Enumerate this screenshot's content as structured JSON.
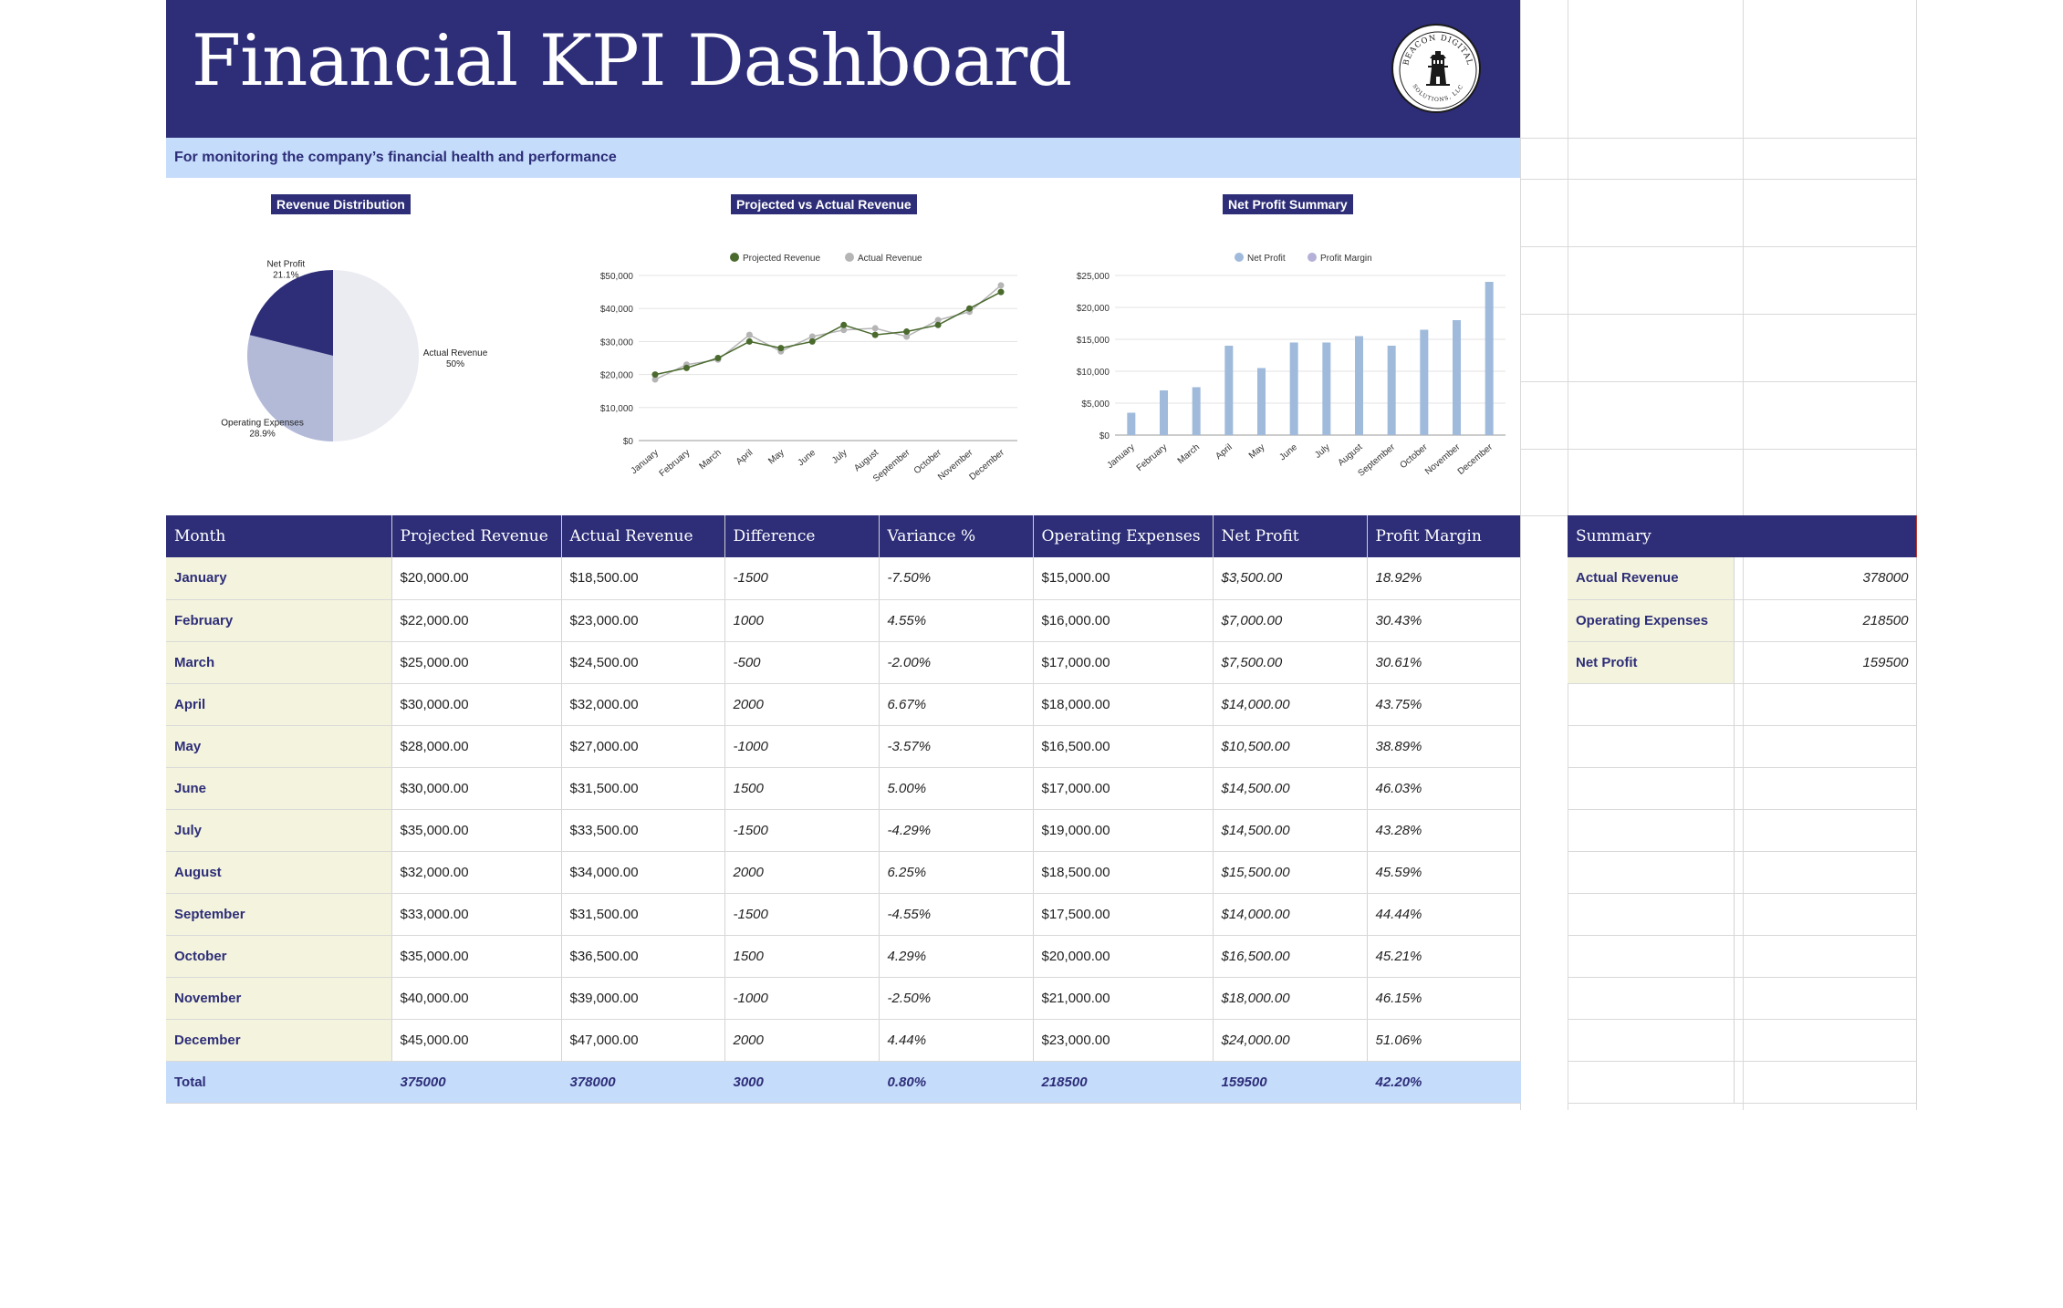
{
  "header": {
    "title": "Financial KPI Dashboard",
    "subtitle": "For monitoring the company’s financial health and performance",
    "logo_text": "BEACON DIGITAL SOLUTIONS, LLC",
    "colors": {
      "banner": "#2d2d78",
      "subtitle_bar": "#c5dcfb",
      "month_cell": "#f4f4de"
    }
  },
  "chart_data": [
    {
      "type": "pie",
      "title": "Revenue Distribution",
      "categories": [
        "Actual Revenue",
        "Operating Expenses",
        "Net Profit"
      ],
      "values": [
        50,
        28.9,
        21.1
      ],
      "labels": [
        "50%",
        "28.9%",
        "21.1%"
      ],
      "colors": [
        "#ebebf2",
        "#b3bad8",
        "#2d2d78"
      ]
    },
    {
      "type": "line",
      "title": "Projected vs Actual Revenue",
      "categories": [
        "January",
        "February",
        "March",
        "April",
        "May",
        "June",
        "July",
        "August",
        "September",
        "October",
        "November",
        "December"
      ],
      "series": [
        {
          "name": "Projected Revenue",
          "values": [
            20000,
            22000,
            25000,
            30000,
            28000,
            30000,
            35000,
            32000,
            33000,
            35000,
            40000,
            45000
          ],
          "color": "#4a6a2e"
        },
        {
          "name": "Actual Revenue",
          "values": [
            18500,
            23000,
            24500,
            32000,
            27000,
            31500,
            33500,
            34000,
            31500,
            36500,
            39000,
            47000
          ],
          "color": "#b5b5b5"
        }
      ],
      "ylim": [
        0,
        50000
      ],
      "yticks": [
        "$0",
        "$10,000",
        "$20,000",
        "$30,000",
        "$40,000",
        "$50,000"
      ],
      "legend": "top",
      "grid": true
    },
    {
      "type": "bar",
      "title": "Net Profit Summary",
      "categories": [
        "January",
        "February",
        "March",
        "April",
        "May",
        "June",
        "July",
        "August",
        "September",
        "October",
        "November",
        "December"
      ],
      "series": [
        {
          "name": "Net Profit",
          "values": [
            3500,
            7000,
            7500,
            14000,
            10500,
            14500,
            14500,
            15500,
            14000,
            16500,
            18000,
            24000
          ],
          "color": "#9fbadb"
        },
        {
          "name": "Profit Margin",
          "values": [],
          "color": "#b4b0d8"
        }
      ],
      "ylim": [
        0,
        25000
      ],
      "yticks": [
        "$0",
        "$5,000",
        "$10,000",
        "$15,000",
        "$20,000",
        "$25,000"
      ],
      "legend": "top",
      "grid": true
    }
  ],
  "table": {
    "headers": [
      "Month",
      "Projected Revenue",
      "Actual Revenue",
      "Difference",
      "Variance %",
      "Operating Expenses",
      "Net Profit",
      "Profit Margin"
    ],
    "rows": [
      [
        "January",
        "$20,000.00",
        "$18,500.00",
        "-1500",
        "-7.50%",
        "$15,000.00",
        "$3,500.00",
        "18.92%"
      ],
      [
        "February",
        "$22,000.00",
        "$23,000.00",
        "1000",
        "4.55%",
        "$16,000.00",
        "$7,000.00",
        "30.43%"
      ],
      [
        "March",
        "$25,000.00",
        "$24,500.00",
        "-500",
        "-2.00%",
        "$17,000.00",
        "$7,500.00",
        "30.61%"
      ],
      [
        "April",
        "$30,000.00",
        "$32,000.00",
        "2000",
        "6.67%",
        "$18,000.00",
        "$14,000.00",
        "43.75%"
      ],
      [
        "May",
        "$28,000.00",
        "$27,000.00",
        "-1000",
        "-3.57%",
        "$16,500.00",
        "$10,500.00",
        "38.89%"
      ],
      [
        "June",
        "$30,000.00",
        "$31,500.00",
        "1500",
        "5.00%",
        "$17,000.00",
        "$14,500.00",
        "46.03%"
      ],
      [
        "July",
        "$35,000.00",
        "$33,500.00",
        "-1500",
        "-4.29%",
        "$19,000.00",
        "$14,500.00",
        "43.28%"
      ],
      [
        "August",
        "$32,000.00",
        "$34,000.00",
        "2000",
        "6.25%",
        "$18,500.00",
        "$15,500.00",
        "45.59%"
      ],
      [
        "September",
        "$33,000.00",
        "$31,500.00",
        "-1500",
        "-4.55%",
        "$17,500.00",
        "$14,000.00",
        "44.44%"
      ],
      [
        "October",
        "$35,000.00",
        "$36,500.00",
        "1500",
        "4.29%",
        "$20,000.00",
        "$16,500.00",
        "45.21%"
      ],
      [
        "November",
        "$40,000.00",
        "$39,000.00",
        "-1000",
        "-2.50%",
        "$21,000.00",
        "$18,000.00",
        "46.15%"
      ],
      [
        "December",
        "$45,000.00",
        "$47,000.00",
        "2000",
        "4.44%",
        "$23,000.00",
        "$24,000.00",
        "51.06%"
      ]
    ],
    "total": [
      "Total",
      "375000",
      "378000",
      "3000",
      "0.80%",
      "218500",
      "159500",
      "42.20%"
    ]
  },
  "summary": {
    "header": "Summary",
    "rows": [
      {
        "label": "Actual Revenue",
        "value": "378000"
      },
      {
        "label": "Operating Expenses",
        "value": "218500"
      },
      {
        "label": "Net Profit",
        "value": "159500"
      }
    ]
  }
}
